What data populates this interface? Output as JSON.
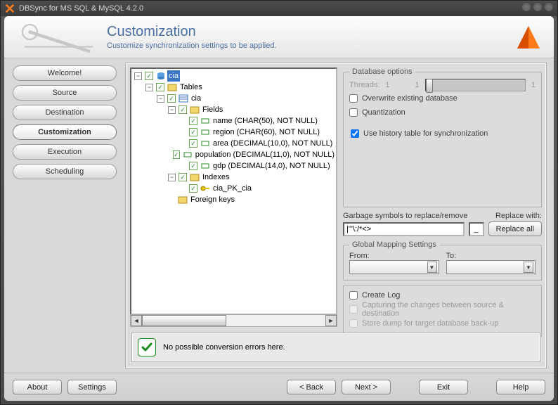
{
  "window": {
    "title": "DBSync for MS SQL & MySQL 4.2.0"
  },
  "header": {
    "title": "Customization",
    "subtitle": "Customize synchronization settings to be applied."
  },
  "sidebar": {
    "items": [
      {
        "label": "Welcome!"
      },
      {
        "label": "Source"
      },
      {
        "label": "Destination"
      },
      {
        "label": "Customization"
      },
      {
        "label": "Execution"
      },
      {
        "label": "Scheduling"
      }
    ],
    "active_index": 3
  },
  "tree": {
    "root": {
      "label": "cia"
    },
    "tables": {
      "label": "Tables"
    },
    "table0": {
      "label": "cia"
    },
    "fields": {
      "label": "Fields"
    },
    "field_items": [
      {
        "label": "name (CHAR(50), NOT NULL)"
      },
      {
        "label": "region (CHAR(60), NOT NULL)"
      },
      {
        "label": "area (DECIMAL(10,0), NOT NULL)"
      },
      {
        "label": "population (DECIMAL(11,0), NOT NULL)"
      },
      {
        "label": "gdp (DECIMAL(14,0), NOT NULL)"
      }
    ],
    "indexes": {
      "label": "Indexes"
    },
    "index_items": [
      {
        "label": "cia_PK_cia"
      }
    ],
    "fkeys": {
      "label": "Foreign keys"
    }
  },
  "options": {
    "group_label": "Database options",
    "threads_label": "Threads:",
    "threads_value": "1",
    "threads_min": "1",
    "threads_max": "1",
    "overwrite": "Overwrite existing database",
    "quantization": "Quantization",
    "use_history": "Use history table for synchronization",
    "garbage_label": "Garbage symbols to replace/remove",
    "garbage_value": "|'\"\\:/*<>",
    "replace_with_label": "Replace with:",
    "replace_with_value": "_",
    "replace_all": "Replace all",
    "mapping_group": "Global Mapping Settings",
    "mapping_from": "From:",
    "mapping_to": "To:",
    "log_create": "Create Log",
    "log_capture": "Capturing the changes between source & destination",
    "log_dump": "Store dump for target database back-up"
  },
  "status": {
    "text": "No possible conversion errors here."
  },
  "footer": {
    "about": "About",
    "settings": "Settings",
    "back": "< Back",
    "next": "Next >",
    "exit": "Exit",
    "help": "Help"
  }
}
